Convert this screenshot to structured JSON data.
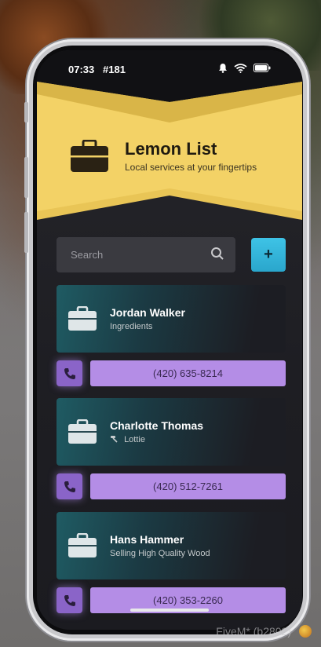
{
  "status_bar": {
    "time": "07:33",
    "id": "#181"
  },
  "app": {
    "title": "Lemon List",
    "subtitle": "Local services at your fingertips",
    "accent_color": "#f1cf5e",
    "card_color": "#1f5b63",
    "phone_color": "#b48de6"
  },
  "search": {
    "placeholder": "Search",
    "value": ""
  },
  "add_button_label": "+",
  "listings": [
    {
      "name": "Jordan Walker",
      "description": "Ingredients",
      "phone": "(420) 635-8214",
      "has_tool_icon": false
    },
    {
      "name": "Charlotte Thomas",
      "description": "Lottie",
      "phone": "(420) 512-7261",
      "has_tool_icon": true
    },
    {
      "name": "Hans Hammer",
      "description": "Selling High Quality Wood",
      "phone": "(420) 353-2260",
      "has_tool_icon": false
    }
  ],
  "watermark": "FiveM* (b2802)"
}
